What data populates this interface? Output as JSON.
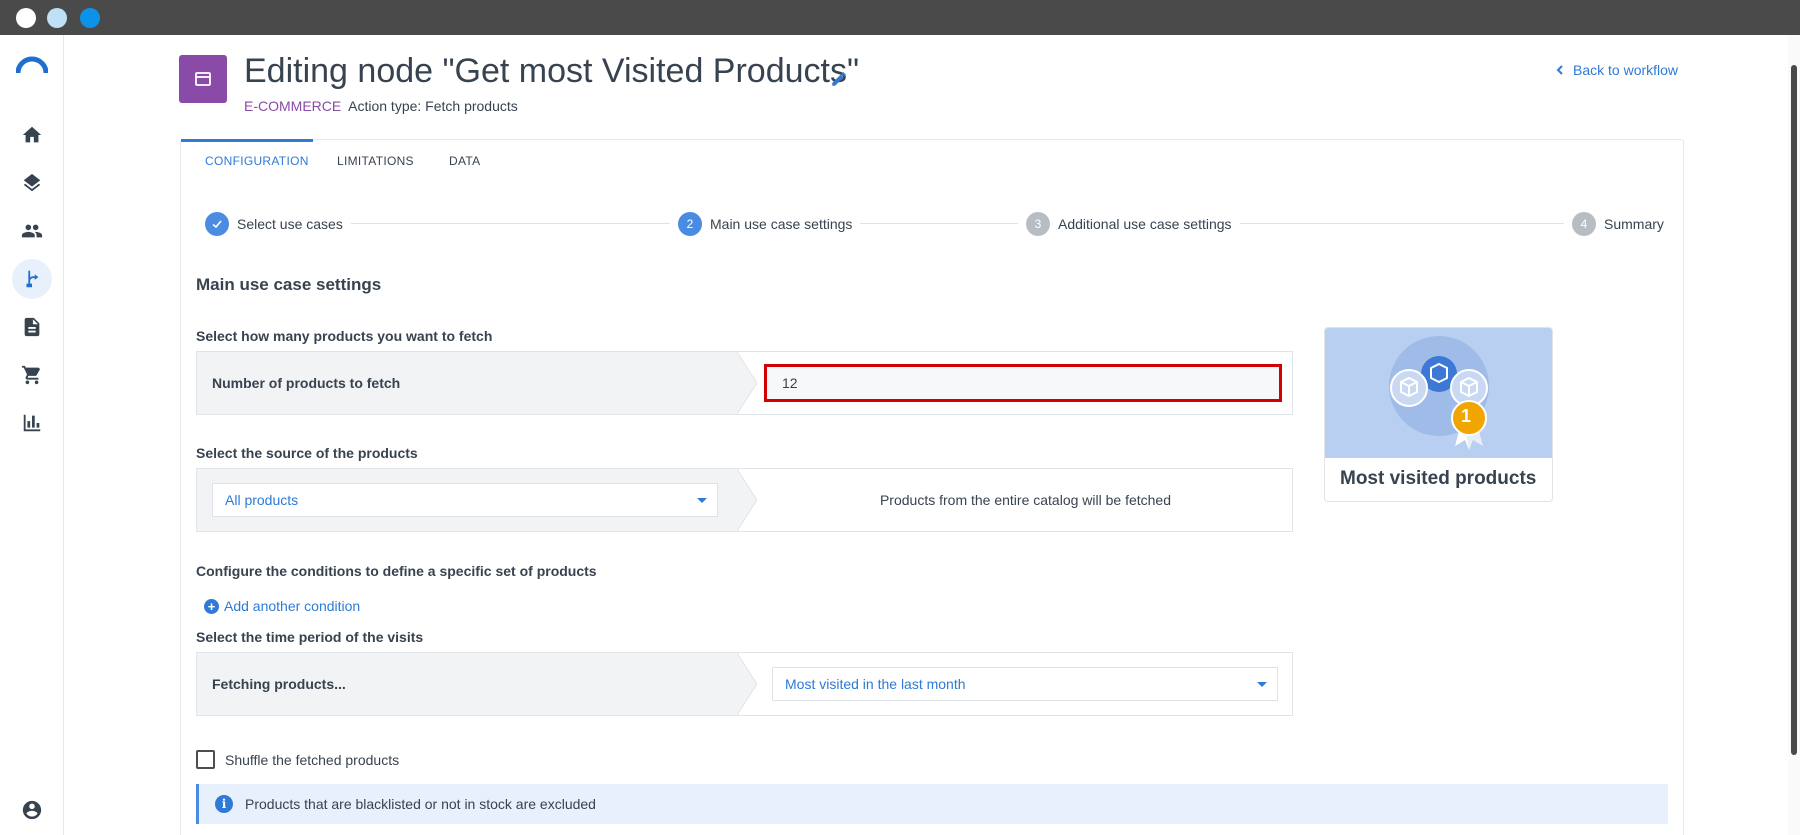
{
  "window": {
    "controls": [
      "close",
      "minimize",
      "maximize"
    ]
  },
  "sidebar": {
    "items": [
      {
        "name": "home",
        "icon": "home-icon"
      },
      {
        "name": "layers",
        "icon": "layers-icon"
      },
      {
        "name": "people",
        "icon": "people-icon"
      },
      {
        "name": "workflows",
        "icon": "workflow-icon",
        "active": true
      },
      {
        "name": "documents",
        "icon": "document-icon"
      },
      {
        "name": "ecommerce",
        "icon": "cart-icon"
      },
      {
        "name": "analytics",
        "icon": "bar-chart-icon"
      },
      {
        "name": "account",
        "icon": "account-icon"
      }
    ]
  },
  "header": {
    "title": "Editing node \"Get most Visited Products\"",
    "category": "E-COMMERCE",
    "action_type": "Action type: Fetch products",
    "back_link": "Back to workflow"
  },
  "tabs": [
    {
      "label": "CONFIGURATION",
      "active": true
    },
    {
      "label": "LIMITATIONS"
    },
    {
      "label": "DATA"
    }
  ],
  "stepper": {
    "steps": [
      {
        "number": "1",
        "label": "Select use cases",
        "state": "done"
      },
      {
        "number": "2",
        "label": "Main use case settings",
        "state": "current"
      },
      {
        "number": "3",
        "label": "Additional use case settings",
        "state": "todo"
      },
      {
        "number": "4",
        "label": "Summary",
        "state": "todo"
      }
    ]
  },
  "main": {
    "section_title": "Main use case settings",
    "count": {
      "question": "Select how many products you want to fetch",
      "label": "Number of products to fetch",
      "value": "12"
    },
    "source": {
      "question": "Select the source of the products",
      "selected": "All products",
      "description": "Products from the entire catalog will be fetched"
    },
    "conditions": {
      "question": "Configure the conditions to define a specific set of products",
      "add_label": "Add another condition"
    },
    "period": {
      "question": "Select the time period of the visits",
      "label": "Fetching products...",
      "selected": "Most visited in the last month"
    },
    "shuffle": {
      "label": "Shuffle the fetched products",
      "checked": false
    },
    "info": "Products that are blacklisted or not in stock are excluded",
    "use_case_card": {
      "title": "Most visited products",
      "badge": "1"
    }
  },
  "colors": {
    "accent": "#2e7ad6",
    "category": "#8a4aa8",
    "highlight_border": "#d40000",
    "info_bg": "#e8f1fb"
  }
}
